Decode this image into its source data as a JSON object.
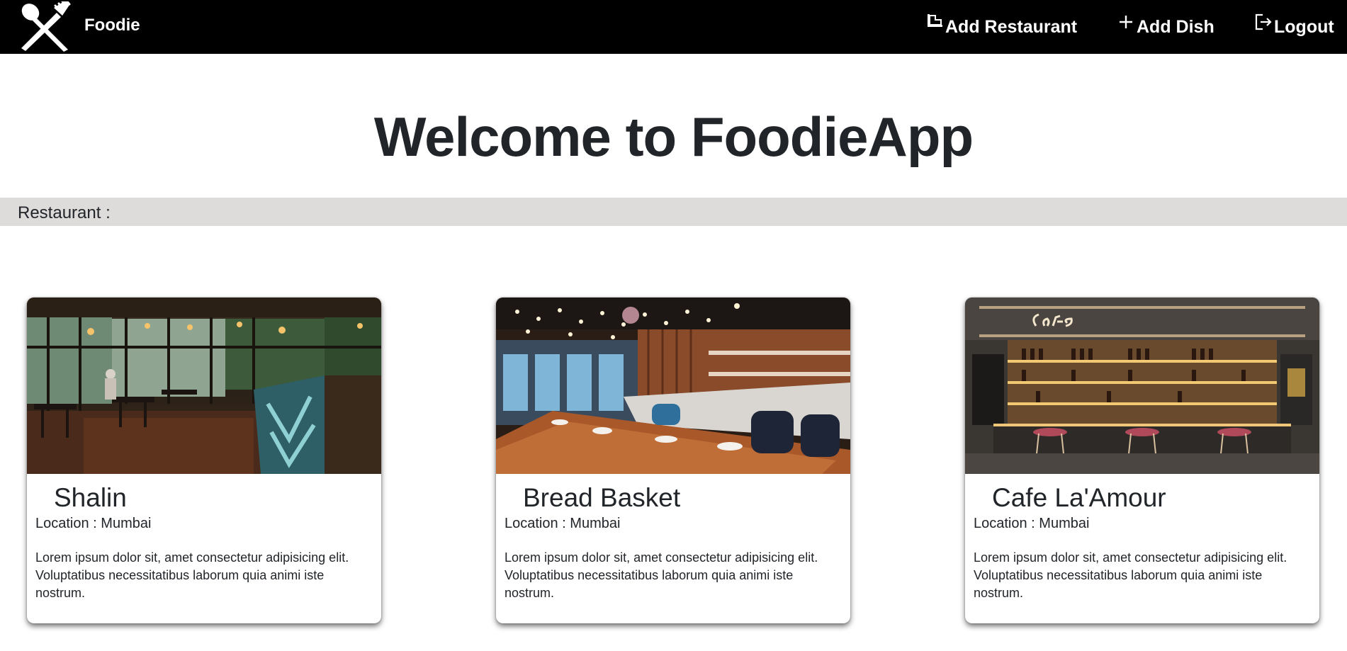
{
  "nav": {
    "brand": "Foodie",
    "links": [
      {
        "label": "Add Restaurant",
        "icon": "add-restaurant-icon"
      },
      {
        "label": "Add Dish",
        "icon": "plus-icon"
      },
      {
        "label": "Logout",
        "icon": "logout-icon"
      }
    ]
  },
  "hero": {
    "title": "Welcome to FoodieApp"
  },
  "section": {
    "label": "Restaurant :"
  },
  "restaurants": [
    {
      "name": "Shalin",
      "location": "Location : Mumbai",
      "description": "Lorem ipsum dolor sit, amet consectetur adipisicing elit. Voluptatibus necessitatibus laborum quia animi iste nostrum.",
      "image": "restaurant-interior-photo"
    },
    {
      "name": "Bread Basket",
      "location": "Location : Mumbai",
      "description": "Lorem ipsum dolor sit, amet consectetur adipisicing elit. Voluptatibus necessitatibus laborum quia animi iste nostrum.",
      "image": "restaurant-dining-table-photo"
    },
    {
      "name": "Cafe La'Amour",
      "location": "Location : Mumbai",
      "description": "Lorem ipsum dolor sit, amet consectetur adipisicing elit. Voluptatibus necessitatibus laborum quia animi iste nostrum.",
      "image": "cafe-bar-counter-photo"
    }
  ],
  "colors": {
    "navbar": "#000000",
    "section_bar": "#dedbdb",
    "text": "#212529"
  }
}
